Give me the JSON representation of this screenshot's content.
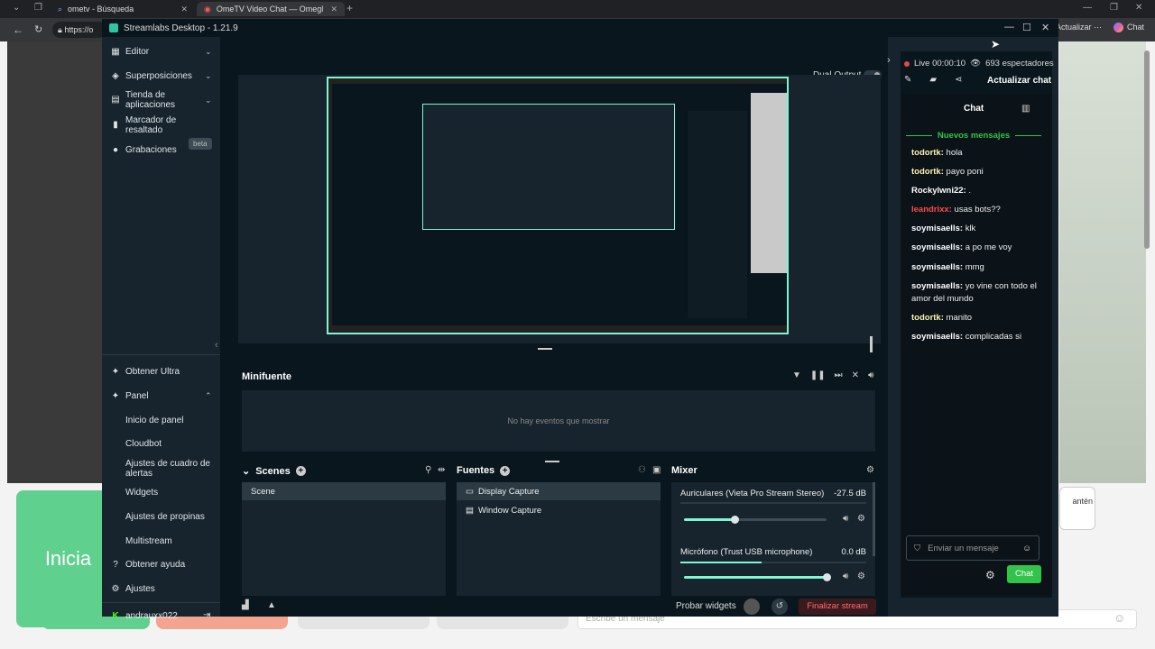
{
  "browser": {
    "tabs": [
      {
        "label": "ometv - Búsqueda"
      },
      {
        "label": "OmeTV Video Chat — Omegl"
      }
    ],
    "address_prefix": "https://o",
    "update_label": "Actualizar",
    "chat_label": "Chat"
  },
  "omegle": {
    "start_label": "Inicia",
    "keep_label": "antén",
    "message_placeholder": "Escribe un mensaje"
  },
  "app": {
    "title": "Streamlabs Desktop - 1.21.9"
  },
  "sidebar": {
    "top_items": [
      {
        "label": "Editor"
      },
      {
        "label": "Superposiciones"
      },
      {
        "label": "Tienda de aplicaciones"
      },
      {
        "label": "Marcador de resaltado"
      },
      {
        "label": "Grabaciones"
      }
    ],
    "beta_label": "beta",
    "ultra_label": "Obtener Ultra",
    "panel_label": "Panel",
    "panel_subitems": [
      {
        "label": "Inicio de panel"
      },
      {
        "label": "Cloudbot"
      },
      {
        "label": "Ajustes de cuadro de alertas"
      },
      {
        "label": "Widgets"
      },
      {
        "label": "Ajustes de propinas"
      },
      {
        "label": "Multistream"
      }
    ],
    "help_label": "Obtener ayuda",
    "settings_label": "Ajustes",
    "user_label": "andrauxx022"
  },
  "header": {
    "dual_output_label": "Dual Output"
  },
  "minifuente": {
    "title": "Minifuente",
    "empty_message": "No hay eventos que mostrar"
  },
  "scenes": {
    "title": "Scenes",
    "items": [
      {
        "label": "Scene"
      }
    ]
  },
  "sources": {
    "title": "Fuentes",
    "items": [
      {
        "label": "Display Capture"
      },
      {
        "label": "Window Capture"
      }
    ]
  },
  "mixer": {
    "title": "Mixer",
    "channels": [
      {
        "label": "Auriculares (Vieta Pro Stream Stereo)",
        "db": "-27.5 dB",
        "volume": 0.36
      },
      {
        "label": "Micrófono (Trust USB microphone)",
        "db": "0.0 dB",
        "volume": 1.0
      }
    ]
  },
  "footer": {
    "test_widgets_label": "Probar widgets",
    "end_stream_label": "Finalizar stream"
  },
  "chat": {
    "live_status": "Live 00:00:10",
    "viewers": "693 espectadores",
    "refresh_label": "Actualizar chat",
    "tab_label": "Chat",
    "new_messages_label": "Nuevos mensajes",
    "messages": [
      {
        "user": "todortk:",
        "text": "hola",
        "color": "#f5f3ac"
      },
      {
        "user": "todortk:",
        "text": "payo poni",
        "color": "#f5f3ac"
      },
      {
        "user": "Rockylwni22:",
        "text": ".",
        "color": "#ffffff"
      },
      {
        "user": "leandrixx:",
        "text": "usas bots??",
        "color": "#ff4a4a"
      },
      {
        "user": "soymisaells:",
        "text": "klk",
        "color": "#ffffff"
      },
      {
        "user": "soymisaells:",
        "text": "a po me voy",
        "color": "#ffffff"
      },
      {
        "user": "soymisaells:",
        "text": "mmg",
        "color": "#ffffff"
      },
      {
        "user": "soymisaells:",
        "text": "yo vine con todo el amor del mundo",
        "color": "#ffffff"
      },
      {
        "user": "todortk:",
        "text": "manito",
        "color": "#f5f3ac"
      },
      {
        "user": "soymisaells:",
        "text": "complicadas si",
        "color": "#ffffff"
      }
    ],
    "input_placeholder": "Enviar un mensaje",
    "send_label": "Chat"
  },
  "colors": {
    "accent": "#80f5d2",
    "send_button": "#31c3a2",
    "live_dot": "#e24a4a",
    "end_stream_bg": "#3a1a1d",
    "end_stream_text": "#ff6b6b"
  }
}
